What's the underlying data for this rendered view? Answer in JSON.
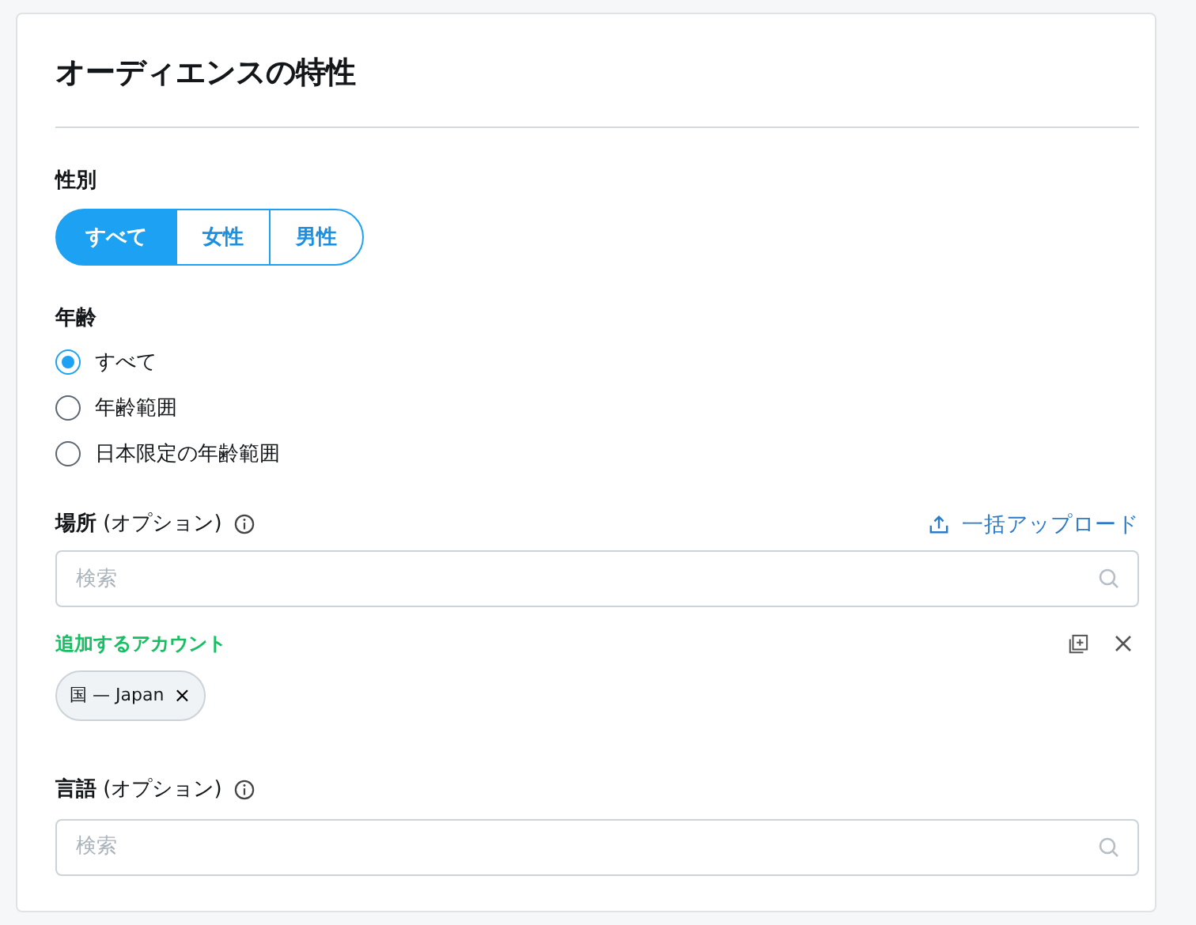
{
  "title": "オーディエンスの特性",
  "gender": {
    "label": "性別",
    "options": [
      {
        "label": "すべて",
        "selected": true
      },
      {
        "label": "女性",
        "selected": false
      },
      {
        "label": "男性",
        "selected": false
      }
    ]
  },
  "age": {
    "label": "年齢",
    "options": [
      {
        "label": "すべて",
        "selected": true
      },
      {
        "label": "年齢範囲",
        "selected": false
      },
      {
        "label": "日本限定の年齢範囲",
        "selected": false
      }
    ]
  },
  "location": {
    "label": "**場所** (オプション)",
    "bulk_upload": "一括アップロード",
    "search": {
      "placeholder": "検索"
    },
    "added_label": "追加するアカウント",
    "chips": [
      {
        "label": "国 — Japan",
        "remove": "×"
      }
    ]
  },
  "language": {
    "label": "**言語** (オプション)",
    "search": {
      "placeholder": "検索"
    }
  }
}
